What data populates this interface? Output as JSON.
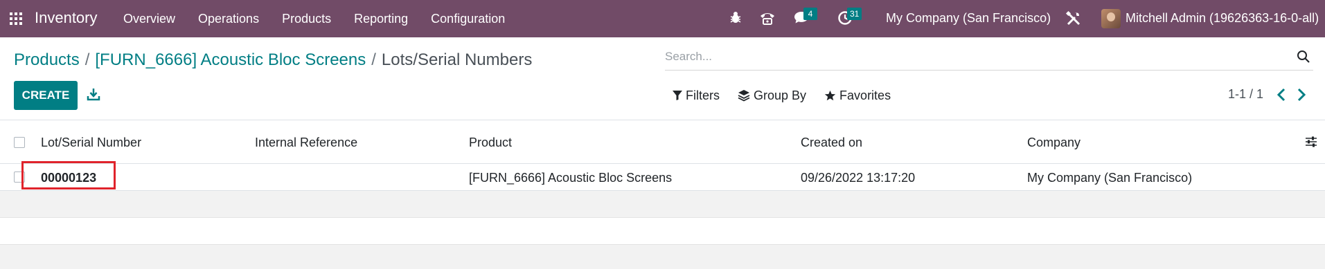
{
  "navbar": {
    "app_name": "Inventory",
    "menu": [
      "Overview",
      "Operations",
      "Products",
      "Reporting",
      "Configuration"
    ],
    "messages_badge": "4",
    "activities_badge": "31",
    "company": "My Company (San Francisco)",
    "user": "Mitchell Admin (19626363-16-0-all)",
    "bar_color": "#714b67"
  },
  "breadcrumb": {
    "items": [
      "Products",
      "[FURN_6666] Acoustic Bloc Screens"
    ],
    "current": "Lots/Serial Numbers"
  },
  "search": {
    "placeholder": "Search..."
  },
  "toolbar": {
    "create_label": "CREATE",
    "filters_label": "Filters",
    "groupby_label": "Group By",
    "favorites_label": "Favorites"
  },
  "pager": {
    "text": "1-1 / 1"
  },
  "table": {
    "columns": [
      "Lot/Serial Number",
      "Internal Reference",
      "Product",
      "Created on",
      "Company"
    ],
    "rows": [
      {
        "lot": "00000123",
        "internal_ref": "",
        "product": "[FURN_6666] Acoustic Bloc Screens",
        "created_on": "09/26/2022 13:17:20",
        "company": "My Company (San Francisco)"
      }
    ]
  },
  "colors": {
    "accent": "#017e84",
    "highlight": "#e0232b"
  }
}
